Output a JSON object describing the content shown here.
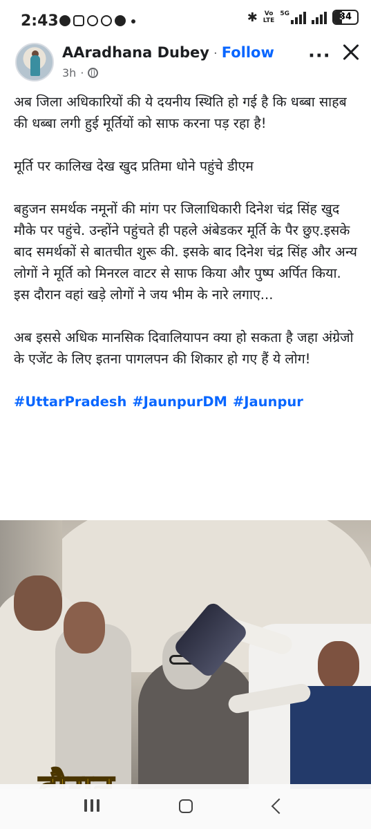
{
  "status_bar": {
    "time": "2:43",
    "network": "5G",
    "volte": "Vo\nLTE",
    "battery_level": "34",
    "battery_fraction": 0.34
  },
  "post": {
    "author": "AAradhana Dubey",
    "separator": "·",
    "follow_label": "Follow",
    "timestamp": "3h",
    "time_separator": "·",
    "more_label": "···",
    "paragraphs": [
      "अब जिला अधिकारियों की ये दयनीय स्थिति हो गई है कि धब्बा साहब की धब्बा लगी हुई मूर्तियों को साफ करना पड़ रहा है!",
      "मूर्ति पर कालिख देख खुद प्रतिमा धोने पहुंचे डीएम",
      "बहुजन समर्थक नमूनों की मांग पर जिलाधिकारी दिनेश चंद्र सिंह खुद मौके पर पहुंचे. उन्होंने पहुंचते ही पहले अंबेडकर मूर्ति के पैर छुए.इसके बाद समर्थकों से बातचीत शुरू की. इसके बाद दिनेश चंद्र सिंह और अन्य लोगों ने मूर्ति को मिनरल वाटर से साफ किया और पुष्प अर्पित किया. इस दौरान वहां खड़े लोगों ने जय भीम के नारे लगाए...",
      "अब इससे अधिक मानसिक दिवालियापन क्या हो सकता है जहा अंग्रेजो के एजेंट के लिए इतना पागलपन की शिकार हो गए हैं ये लोग!"
    ],
    "hashtags": [
      "#UttarPradesh",
      "#JaunpurDM",
      "#Jaunpur"
    ],
    "image_caption_partial": "दौरान"
  },
  "colors": {
    "link": "#0866ff",
    "text": "#1c1e21",
    "muted": "#65676b",
    "caption": "#f5c20f"
  },
  "icons": {
    "status_apps": [
      "facebook-icon",
      "instagram-icon",
      "messenger-icon",
      "whatsapp-icon",
      "facebook-icon"
    ],
    "header": [
      "globe-icon",
      "more-icon",
      "close-icon"
    ],
    "nav": [
      "recent-apps-icon",
      "home-icon",
      "back-icon"
    ]
  }
}
